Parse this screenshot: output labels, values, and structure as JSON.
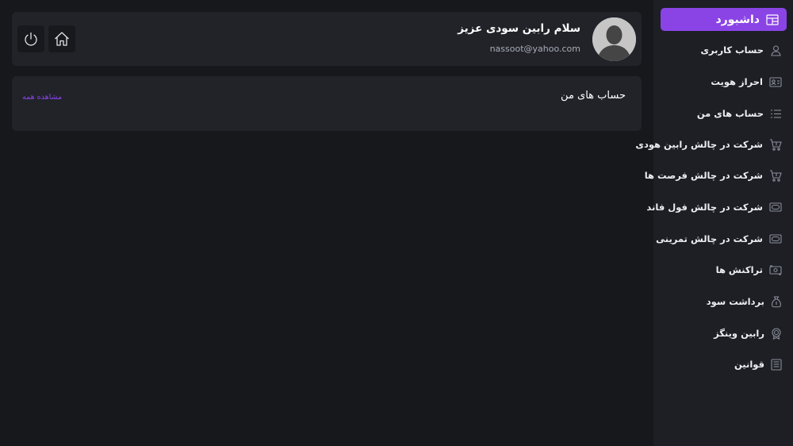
{
  "header": {
    "greeting": "سلام رابین سودی عزیز",
    "email": "nassoot@yahoo.com",
    "home_icon": "home-icon",
    "power_icon": "power-icon"
  },
  "accounts": {
    "title": "حساب های من",
    "view_all": "مشاهده همه"
  },
  "sidebar": {
    "active": {
      "label": "داشبورد",
      "icon": "dashboard-icon"
    },
    "items": [
      {
        "label": "حساب کاربری",
        "icon": "user-icon"
      },
      {
        "label": "احراز هویت",
        "icon": "id-card-icon"
      },
      {
        "label": "حساب های من",
        "icon": "list-icon"
      },
      {
        "label": "شرکت در چالش رابین هودی",
        "icon": "cart-icon"
      },
      {
        "label": "شرکت در چالش فرصت ها",
        "icon": "cart-icon"
      },
      {
        "label": "شرکت در چالش فول فاند",
        "icon": "money-icon"
      },
      {
        "label": "شرکت در چالش تمرینی",
        "icon": "money-icon"
      },
      {
        "label": "تراکنش ها",
        "icon": "transaction-icon"
      },
      {
        "label": "برداشت سود",
        "icon": "money-bag-icon"
      },
      {
        "label": "رابین وینگز",
        "icon": "badge-icon"
      },
      {
        "label": "قوانین",
        "icon": "document-icon"
      }
    ]
  },
  "colors": {
    "accent": "#8a44e5",
    "background": "#16181c",
    "sidebar": "#1d1f25",
    "card": "#212329"
  }
}
